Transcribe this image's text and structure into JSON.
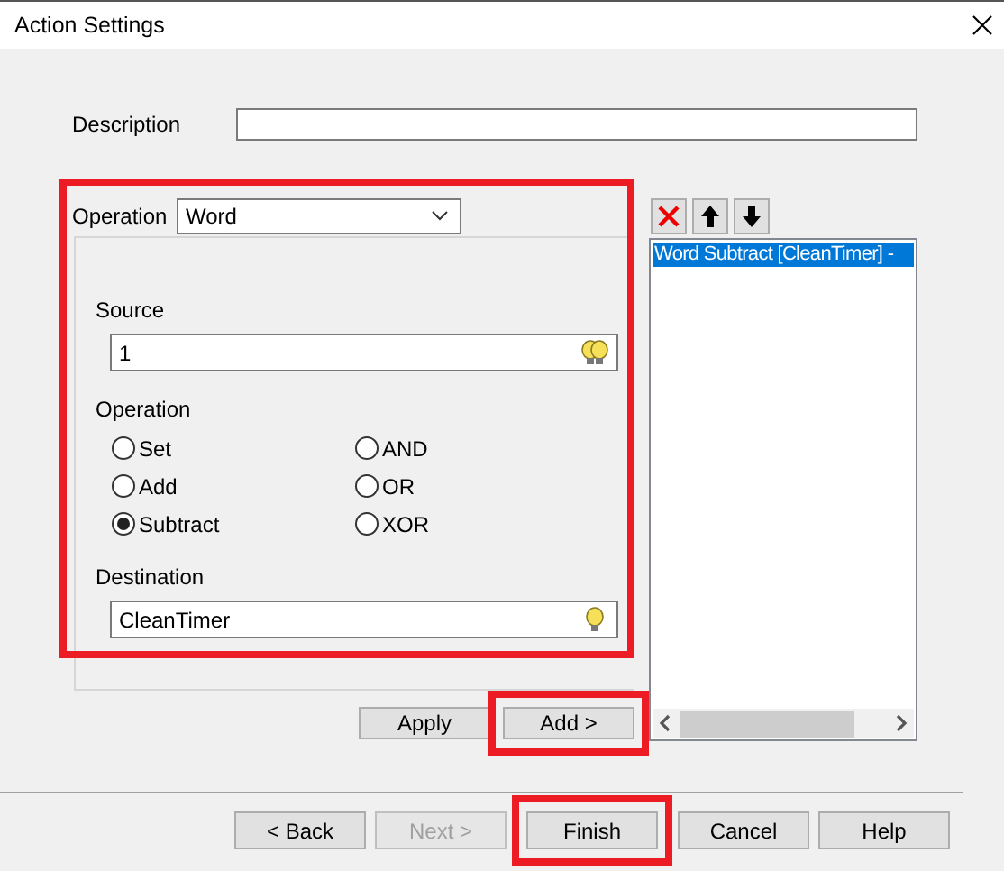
{
  "window": {
    "title": "Action Settings"
  },
  "description": {
    "label": "Description"
  },
  "operation_type": {
    "label": "Operation",
    "value": "Word",
    "highlighted": true
  },
  "source": {
    "label": "Source",
    "value": "1"
  },
  "operation": {
    "label": "Operation",
    "options": [
      {
        "label": "Set",
        "selected": false
      },
      {
        "label": "Add",
        "selected": false
      },
      {
        "label": "Subtract",
        "selected": true
      },
      {
        "label": "AND",
        "selected": false
      },
      {
        "label": "OR",
        "selected": false
      },
      {
        "label": "XOR",
        "selected": false
      }
    ]
  },
  "destination": {
    "label": "Destination",
    "value": "CleanTimer"
  },
  "actions_list": {
    "items": [
      {
        "label": "Word Subtract [CleanTimer] -",
        "selected": true
      }
    ]
  },
  "panel_buttons": [
    {
      "label": "Apply",
      "highlighted": false
    },
    {
      "label": "Add >",
      "highlighted": true
    }
  ],
  "footer_buttons": [
    {
      "label": "< Back",
      "disabled": false,
      "highlighted": false
    },
    {
      "label": "Next >",
      "disabled": true,
      "highlighted": false
    },
    {
      "label": "Finish",
      "disabled": false,
      "highlighted": true
    },
    {
      "label": "Cancel",
      "disabled": false,
      "highlighted": false
    },
    {
      "label": "Help",
      "disabled": false,
      "highlighted": false
    }
  ]
}
